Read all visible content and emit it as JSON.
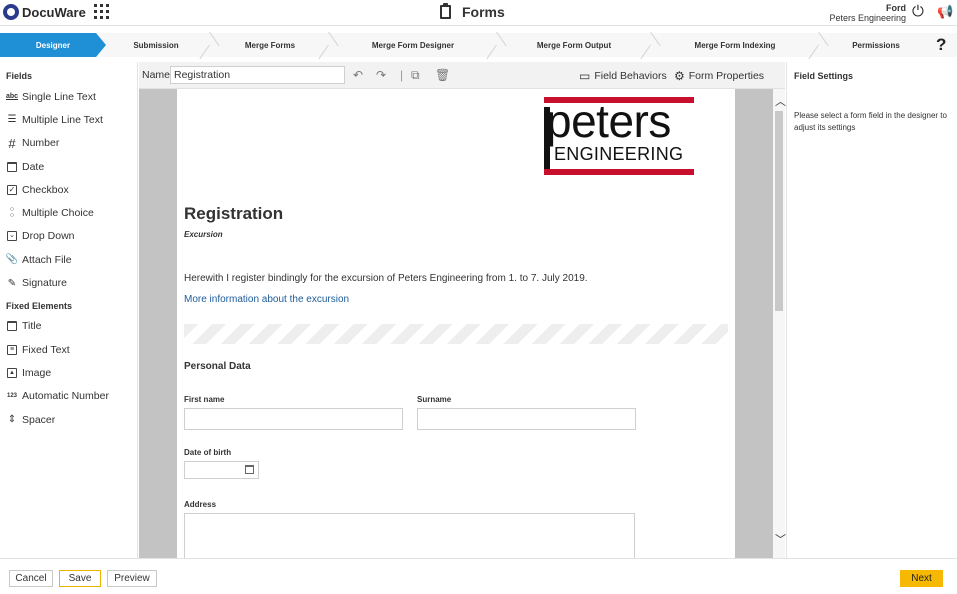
{
  "header": {
    "brand": "DocuWare",
    "app_title": "Forms",
    "user_name": "Ford",
    "user_org": "Peters Engineering"
  },
  "steps": [
    {
      "label": "Designer",
      "active": true
    },
    {
      "label": "Submission"
    },
    {
      "label": "Merge Forms"
    },
    {
      "label": "Merge Form Designer"
    },
    {
      "label": "Merge Form Output"
    },
    {
      "label": "Merge Form Indexing"
    },
    {
      "label": "Permissions"
    }
  ],
  "help_label": "?",
  "sidebar": {
    "fields_heading": "Fields",
    "fields": [
      {
        "label": "Single Line Text",
        "icon": "single-line-text-icon"
      },
      {
        "label": "Multiple Line Text",
        "icon": "multiple-line-text-icon"
      },
      {
        "label": "Number",
        "icon": "hash-icon"
      },
      {
        "label": "Date",
        "icon": "calendar-icon"
      },
      {
        "label": "Checkbox",
        "icon": "checkbox-icon"
      },
      {
        "label": "Multiple Choice",
        "icon": "radio-list-icon"
      },
      {
        "label": "Drop Down",
        "icon": "dropdown-icon"
      },
      {
        "label": "Attach File",
        "icon": "paperclip-icon"
      },
      {
        "label": "Signature",
        "icon": "pen-icon"
      }
    ],
    "fixed_heading": "Fixed Elements",
    "fixed": [
      {
        "label": "Title",
        "icon": "title-icon"
      },
      {
        "label": "Fixed Text",
        "icon": "text-block-icon"
      },
      {
        "label": "Image",
        "icon": "image-icon"
      },
      {
        "label": "Automatic Number",
        "icon": "auto-number-icon"
      },
      {
        "label": "Spacer",
        "icon": "spacer-icon"
      }
    ],
    "auto_number_glyph": "123",
    "single_line_glyph": "abc"
  },
  "toolbar": {
    "name_label": "Name",
    "name_value": "Registration",
    "field_behaviors": "Field Behaviors",
    "form_properties": "Form Properties"
  },
  "form": {
    "logo_word": "peters",
    "logo_sub": "ENGINEERING",
    "title": "Registration",
    "subtitle": "Excursion",
    "intro": "Herewith I register bindingly for the excursion of Peters Engineering from 1. to 7. July 2019.",
    "link": "More information about the excursion",
    "section": "Personal Data",
    "first_name_label": "First name",
    "surname_label": "Surname",
    "dob_label": "Date of birth",
    "address_label": "Address"
  },
  "field_settings": {
    "heading": "Field Settings",
    "hint": "Please select a form field in the designer to adjust its settings"
  },
  "footer": {
    "cancel": "Cancel",
    "save": "Save",
    "preview": "Preview",
    "next": "Next"
  },
  "colors": {
    "accent": "#1f90d6",
    "next": "#f6b800",
    "brand_red": "#c8102e",
    "link": "#1d5c99"
  }
}
